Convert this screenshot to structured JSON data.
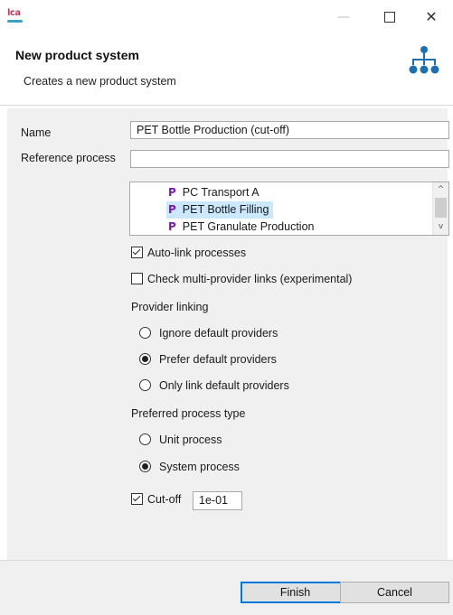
{
  "window": {
    "app_logo": "LCA",
    "controls": {
      "minimize": "—",
      "maximize": "☐",
      "close": "✕"
    }
  },
  "header": {
    "title": "New product system",
    "subtitle": "Creates a new product system",
    "icon": "product-system-tree-icon"
  },
  "form": {
    "name_label": "Name",
    "name_value": "PET Bottle Production (cut-off)",
    "reference_label": "Reference process",
    "reference_filter_value": "",
    "process_list": [
      {
        "icon": "P",
        "label": "PC Transport A",
        "selected": false
      },
      {
        "icon": "P",
        "label": "PET Bottle Filling",
        "selected": true
      },
      {
        "icon": "P",
        "label": "PET Granulate Production",
        "selected": false
      }
    ],
    "auto_link": {
      "label": "Auto-link processes",
      "checked": true
    },
    "multi_provider": {
      "label": "Check multi-provider links (experimental)",
      "checked": false
    },
    "provider_linking": {
      "label": "Provider linking",
      "options": [
        {
          "label": "Ignore default providers",
          "selected": false
        },
        {
          "label": "Prefer default providers",
          "selected": true
        },
        {
          "label": "Only link default providers",
          "selected": false
        }
      ]
    },
    "process_type": {
      "label": "Preferred process type",
      "options": [
        {
          "label": "Unit process",
          "selected": false
        },
        {
          "label": "System process",
          "selected": true
        }
      ]
    },
    "cutoff": {
      "label": "Cut-off",
      "checked": true,
      "value": "1e-01"
    }
  },
  "buttons": {
    "finish": "Finish",
    "cancel": "Cancel"
  }
}
